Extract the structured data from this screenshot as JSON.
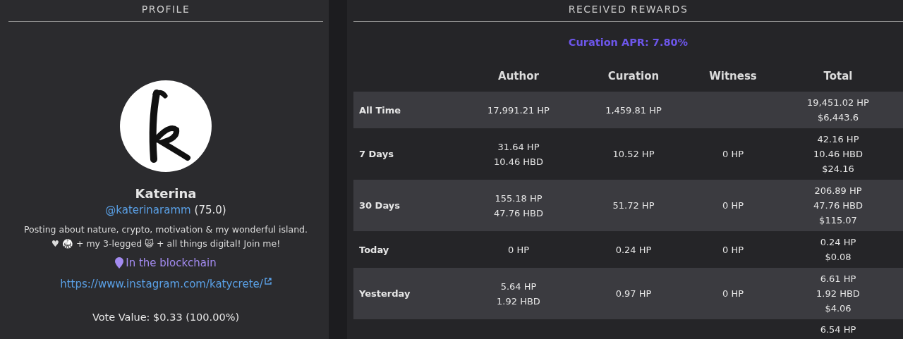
{
  "profile": {
    "heading": "PROFILE",
    "avatar": {
      "kind": "picture"
    },
    "name": "Katerina",
    "handle": "@katerinaramm",
    "reputation": "(75.0)",
    "bio": [
      "Posting about nature, crypto, motivation & my wonderful island.",
      "♥ 🥋 + my 3-legged 🙀 + all things digital! Join me!"
    ],
    "location": "In the blockchain",
    "website": "https://www.instagram.com/katycrete/",
    "vote_value": "Vote Value: $0.33 (100.00%)"
  },
  "rewards": {
    "heading": "RECEIVED REWARDS",
    "apr": "Curation APR: 7.80%",
    "columns": [
      "Author",
      "Curation",
      "Witness",
      "Total"
    ],
    "rows": [
      {
        "label": "All Time",
        "author": [
          "17,991.21 HP"
        ],
        "curation": [
          "1,459.81 HP"
        ],
        "total": [
          "19,451.02 HP",
          "$6,443.6"
        ]
      },
      {
        "label": "7 Days",
        "author": [
          "31.64 HP",
          "10.46 HBD"
        ],
        "curation": [
          "10.52 HP"
        ],
        "witness": [
          "0 HP"
        ],
        "total": [
          "42.16 HP",
          "10.46 HBD",
          "$24.16"
        ]
      },
      {
        "label": "30 Days",
        "author": [
          "155.18 HP",
          "47.76 HBD"
        ],
        "curation": [
          "51.72 HP"
        ],
        "witness": [
          "0 HP"
        ],
        "total": [
          "206.89 HP",
          "47.76 HBD",
          "$115.07"
        ]
      },
      {
        "label": "Today",
        "author": [
          "0 HP"
        ],
        "curation": [
          "0.24 HP"
        ],
        "witness": [
          "0 HP"
        ],
        "total": [
          "0.24 HP",
          "$0.08"
        ]
      },
      {
        "label": "Yesterday",
        "author": [
          "5.64 HP",
          "1.92 HBD"
        ],
        "curation": [
          "0.97 HP"
        ],
        "witness": [
          "0 HP"
        ],
        "total": [
          "6.61 HP",
          "1.92 HBD",
          "$4.06"
        ]
      },
      {
        "total": [
          "6.54 HP"
        ]
      }
    ]
  }
}
